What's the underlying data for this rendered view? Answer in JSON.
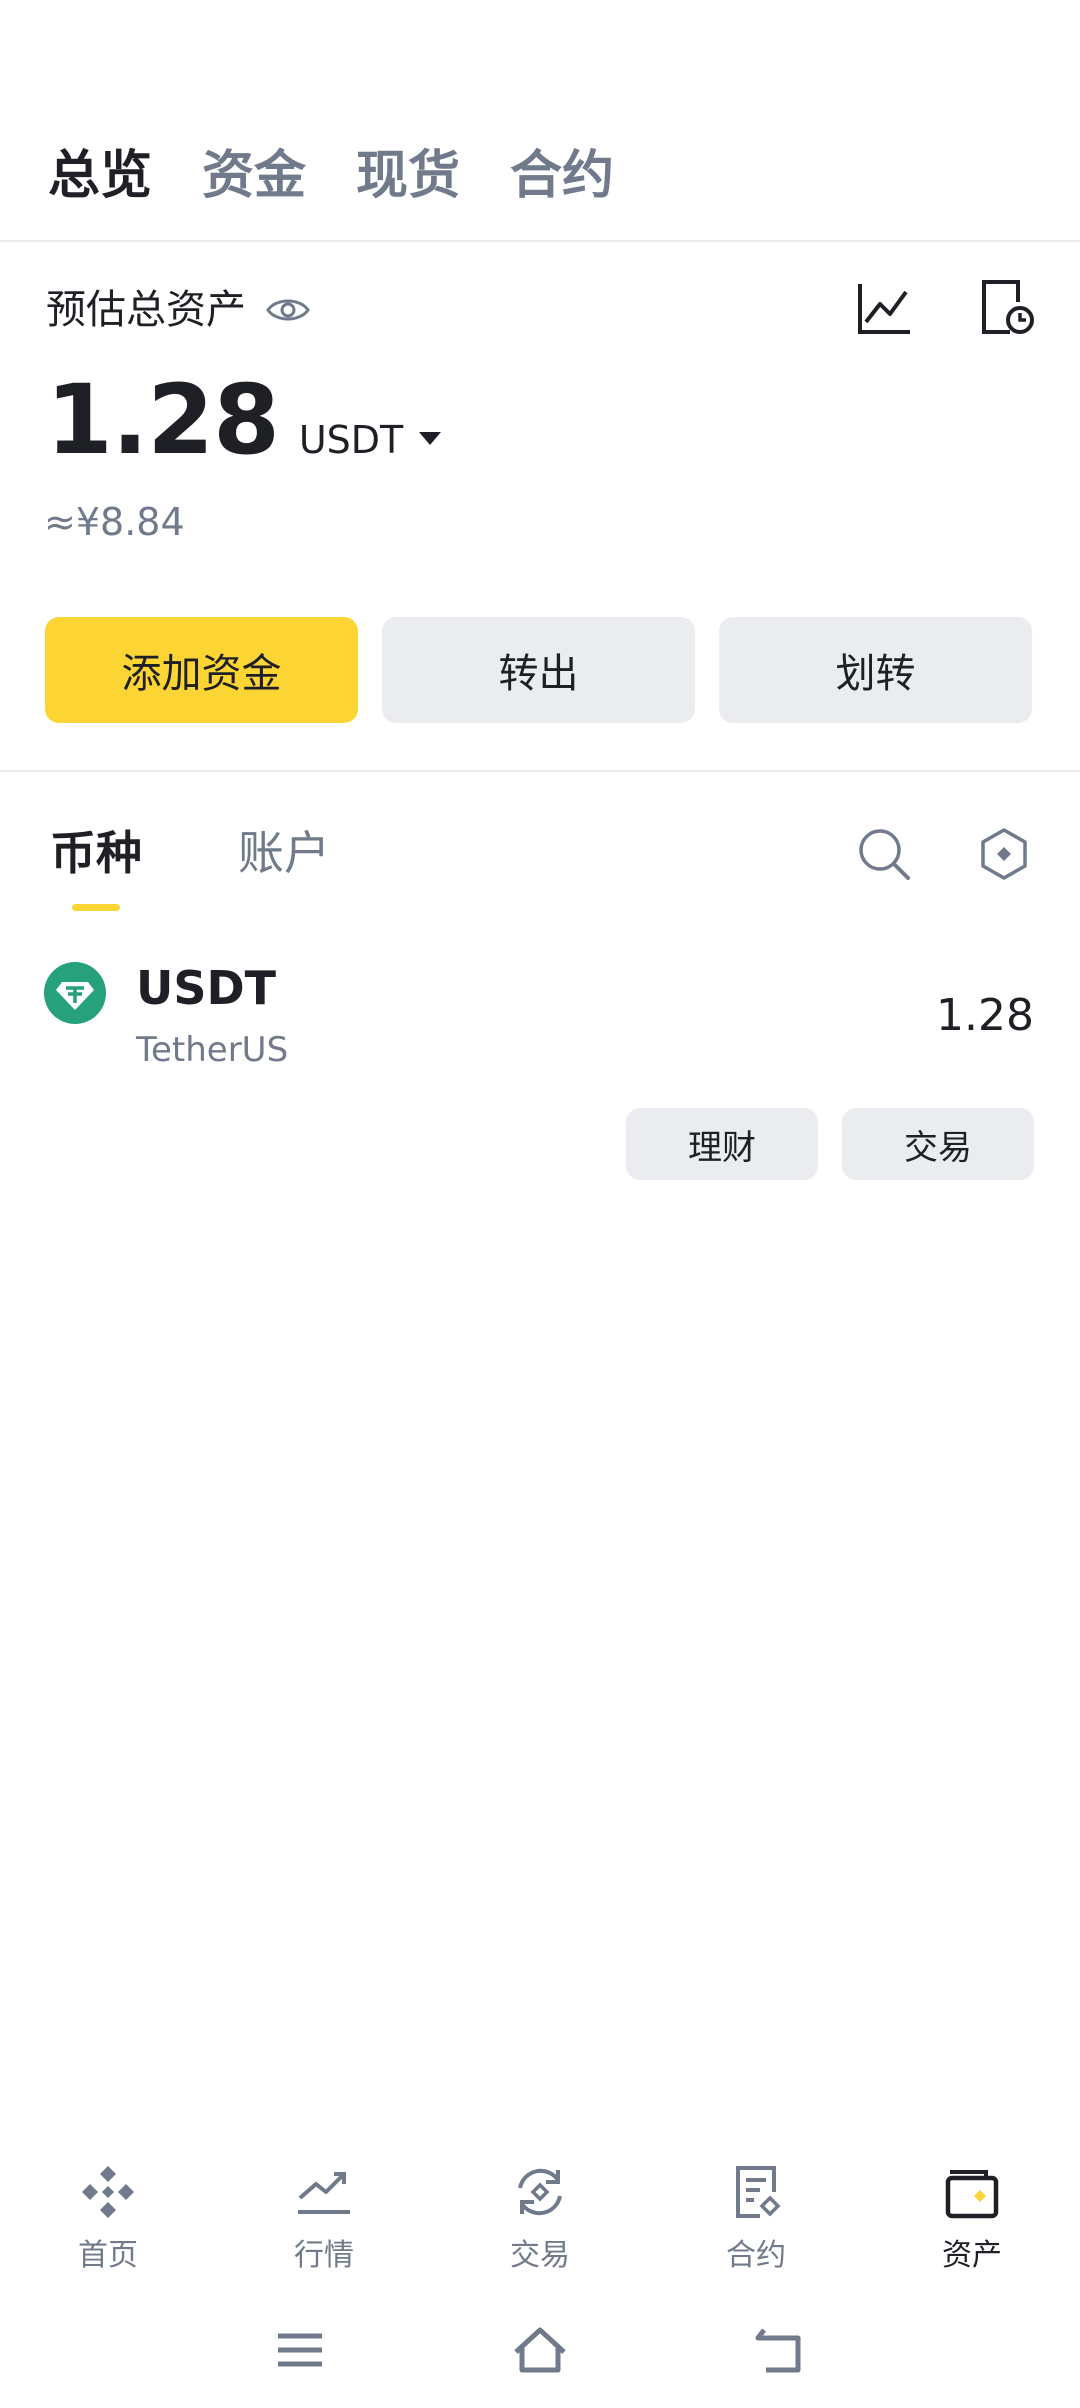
{
  "top_tabs": [
    {
      "label": "总览",
      "active": true
    },
    {
      "label": "资金",
      "active": false
    },
    {
      "label": "现货",
      "active": false
    },
    {
      "label": "合约",
      "active": false
    }
  ],
  "header": {
    "est_label": "预估总资产",
    "balance": "1.28",
    "unit": "USDT",
    "cny_value": "≈¥8.84",
    "icons": [
      "eye-icon",
      "chart-icon",
      "history-icon"
    ]
  },
  "actions": {
    "add_funds": "添加资金",
    "withdraw": "转出",
    "transfer": "划转"
  },
  "section_tabs": [
    {
      "label": "币种",
      "active": true
    },
    {
      "label": "账户",
      "active": false
    }
  ],
  "section_icons": [
    "search-icon",
    "settings-hex-icon"
  ],
  "coins": [
    {
      "symbol": "USDT",
      "name": "TetherUS",
      "amount": "1.28",
      "earn_label": "理财",
      "trade_label": "交易"
    }
  ],
  "bottom_nav": [
    {
      "label": "首页",
      "icon": "binance-logo-icon",
      "active": false
    },
    {
      "label": "行情",
      "icon": "market-chart-icon",
      "active": false
    },
    {
      "label": "交易",
      "icon": "trade-exchange-icon",
      "active": false
    },
    {
      "label": "合约",
      "icon": "futures-doc-icon",
      "active": false
    },
    {
      "label": "资产",
      "icon": "wallet-icon",
      "active": true
    }
  ],
  "colors": {
    "accent": "#fcd535",
    "text_primary": "#1e2026",
    "text_secondary": "#707a8a",
    "button_gray": "#eaecef",
    "tether_green": "#26a17b"
  }
}
